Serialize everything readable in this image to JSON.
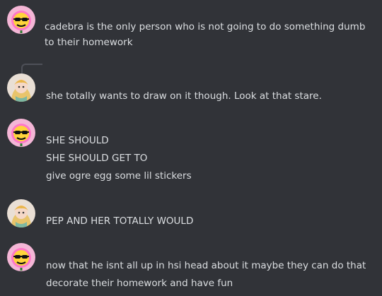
{
  "messages": [
    {
      "avatar": "sunglasses-flower-avatar",
      "lines": [
        "cadebra is the only person who is not going to do something dumb to their homework"
      ]
    },
    {
      "avatar": "blonde-girl-avatar",
      "lines": [
        "she totally wants to draw on it though. Look at that stare."
      ]
    },
    {
      "avatar": "sunglasses-flower-avatar",
      "lines": [
        "SHE SHOULD",
        "SHE SHOULD GET TO",
        "give ogre egg some lil stickers"
      ]
    },
    {
      "avatar": "blonde-girl-avatar",
      "lines": [
        "PEP AND HER TOTALLY WOULD"
      ]
    },
    {
      "avatar": "sunglasses-flower-avatar",
      "lines": [
        "now that he isnt all up in hsi head about it maybe they can do that",
        "decorate their homework and have fun"
      ]
    }
  ],
  "colors": {
    "background": "#313338",
    "text": "#dbdee1",
    "reply_spine": "#4e5058"
  }
}
